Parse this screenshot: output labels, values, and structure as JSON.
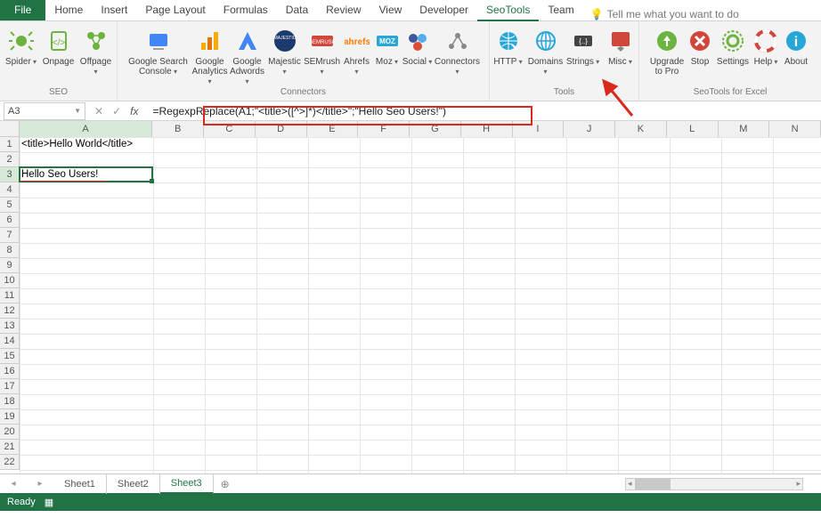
{
  "tabs": {
    "file": "File",
    "home": "Home",
    "insert": "Insert",
    "pagelayout": "Page Layout",
    "formulas": "Formulas",
    "data": "Data",
    "review": "Review",
    "view": "View",
    "developer": "Developer",
    "seotools": "SeoTools",
    "team": "Team",
    "tellme": "Tell me what you want to do"
  },
  "ribbon": {
    "seo": {
      "label": "SEO",
      "spider": "Spider",
      "onpage": "Onpage",
      "offpage": "Offpage"
    },
    "connectors": {
      "label": "Connectors",
      "gsc": "Google Search Console",
      "ga": "Google Analytics",
      "gaw": "Google Adwords",
      "majestic": "Majestic",
      "semrush": "SEMrush",
      "ahrefs": "Ahrefs",
      "moz": "Moz",
      "social": "Social",
      "connectors": "Connectors"
    },
    "tools": {
      "label": "Tools",
      "http": "HTTP",
      "domains": "Domains",
      "strings": "Strings",
      "misc": "Misc"
    },
    "seotoolsforexcel": {
      "label": "SeoTools for Excel",
      "upgrade": "Upgrade to Pro",
      "stop": "Stop",
      "settings": "Settings",
      "help": "Help",
      "about": "About"
    }
  },
  "formulabar": {
    "name": "A3",
    "formula": "=RegexpReplace(A1;\"<title>([^>]*)</title>\";\"Hello Seo Users!\")"
  },
  "columns": [
    "A",
    "B",
    "C",
    "D",
    "E",
    "F",
    "G",
    "H",
    "I",
    "J",
    "K",
    "L",
    "M",
    "N"
  ],
  "rows": 22,
  "cells": {
    "A1": "<title>Hello World</title>",
    "A3": "Hello Seo Users!"
  },
  "selected": {
    "cell": "A3",
    "row": 3,
    "col": "A"
  },
  "sheets": {
    "items": [
      "Sheet1",
      "Sheet2",
      "Sheet3"
    ],
    "active": "Sheet3"
  },
  "status": {
    "ready": "Ready"
  }
}
